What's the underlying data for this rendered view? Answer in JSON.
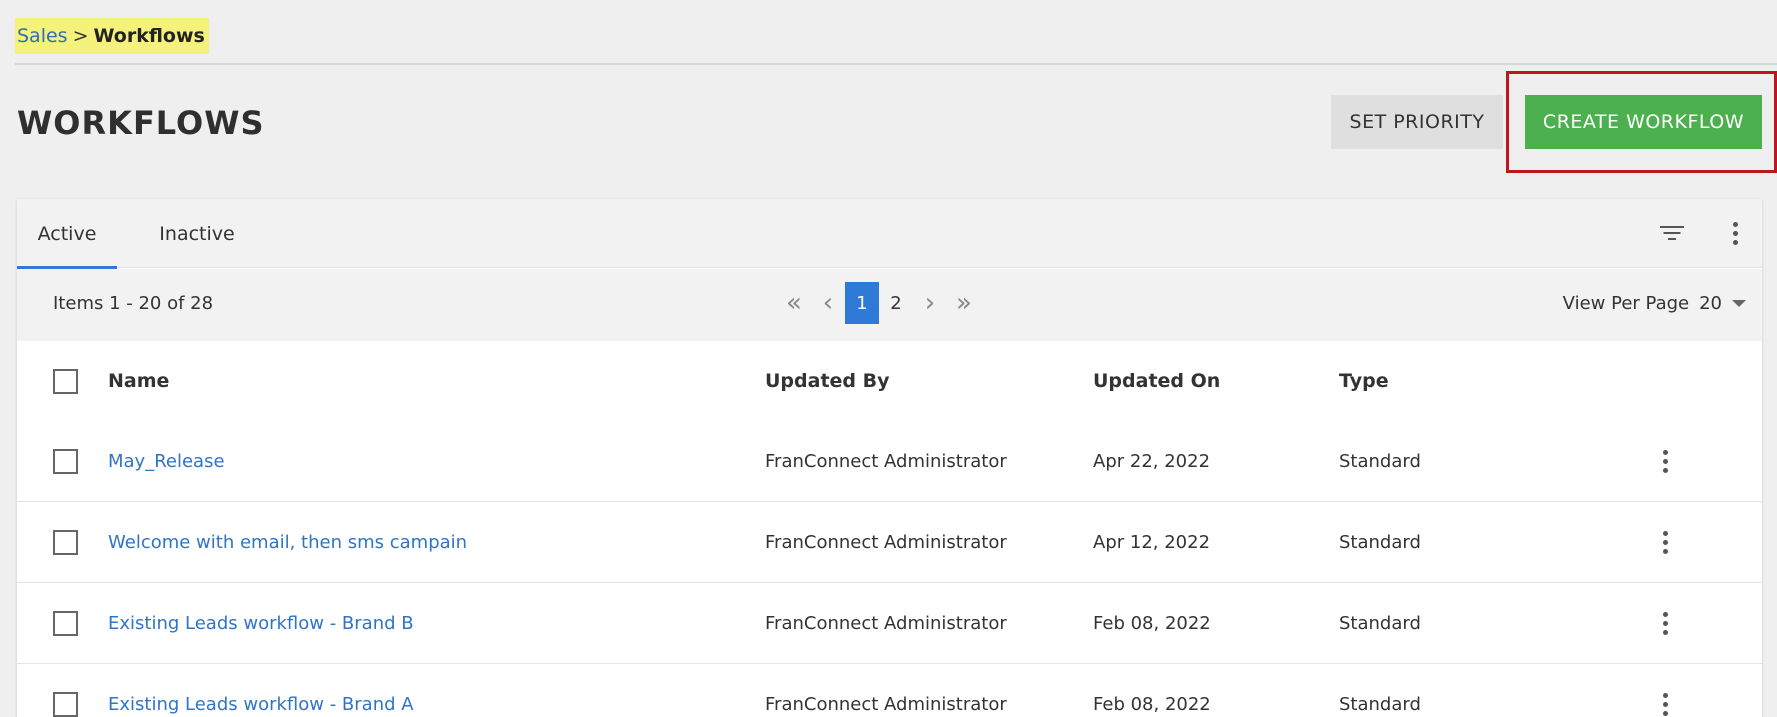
{
  "breadcrumb": {
    "parent": "Sales",
    "separator": ">",
    "current": "Workflows"
  },
  "header": {
    "title": "WORKFLOWS",
    "set_priority_label": "SET PRIORITY",
    "create_label": "CREATE WORKFLOW"
  },
  "tabs": [
    {
      "label": "Active",
      "active": true
    },
    {
      "label": "Inactive",
      "active": false
    }
  ],
  "pagination": {
    "items_text": "Items 1 - 20 of 28",
    "pages": [
      "1",
      "2"
    ],
    "current_page": "1",
    "view_per_page_label": "View Per Page",
    "per_page_value": "20"
  },
  "table": {
    "columns": {
      "name": "Name",
      "updated_by": "Updated By",
      "updated_on": "Updated On",
      "type": "Type"
    },
    "rows": [
      {
        "name": "May_Release",
        "updated_by": "FranConnect Administrator",
        "updated_on": "Apr 22, 2022",
        "type": "Standard"
      },
      {
        "name": "Welcome with email, then sms campain",
        "updated_by": "FranConnect Administrator",
        "updated_on": "Apr 12, 2022",
        "type": "Standard"
      },
      {
        "name": "Existing Leads workflow - Brand B",
        "updated_by": "FranConnect Administrator",
        "updated_on": "Feb 08, 2022",
        "type": "Standard"
      },
      {
        "name": "Existing Leads workflow - Brand A",
        "updated_by": "FranConnect Administrator",
        "updated_on": "Feb 08, 2022",
        "type": "Standard"
      }
    ]
  },
  "colors": {
    "accent": "#2f7ad6",
    "create_button": "#4cb04f",
    "highlight_outline": "#c0141f",
    "breadcrumb_highlight": "#f4f27a",
    "link": "#2f74c8"
  },
  "icons": [
    "filter-icon",
    "more-vertical-icon",
    "first-page-icon",
    "prev-page-icon",
    "next-page-icon",
    "last-page-icon",
    "dropdown-caret-icon",
    "checkbox-icon"
  ]
}
